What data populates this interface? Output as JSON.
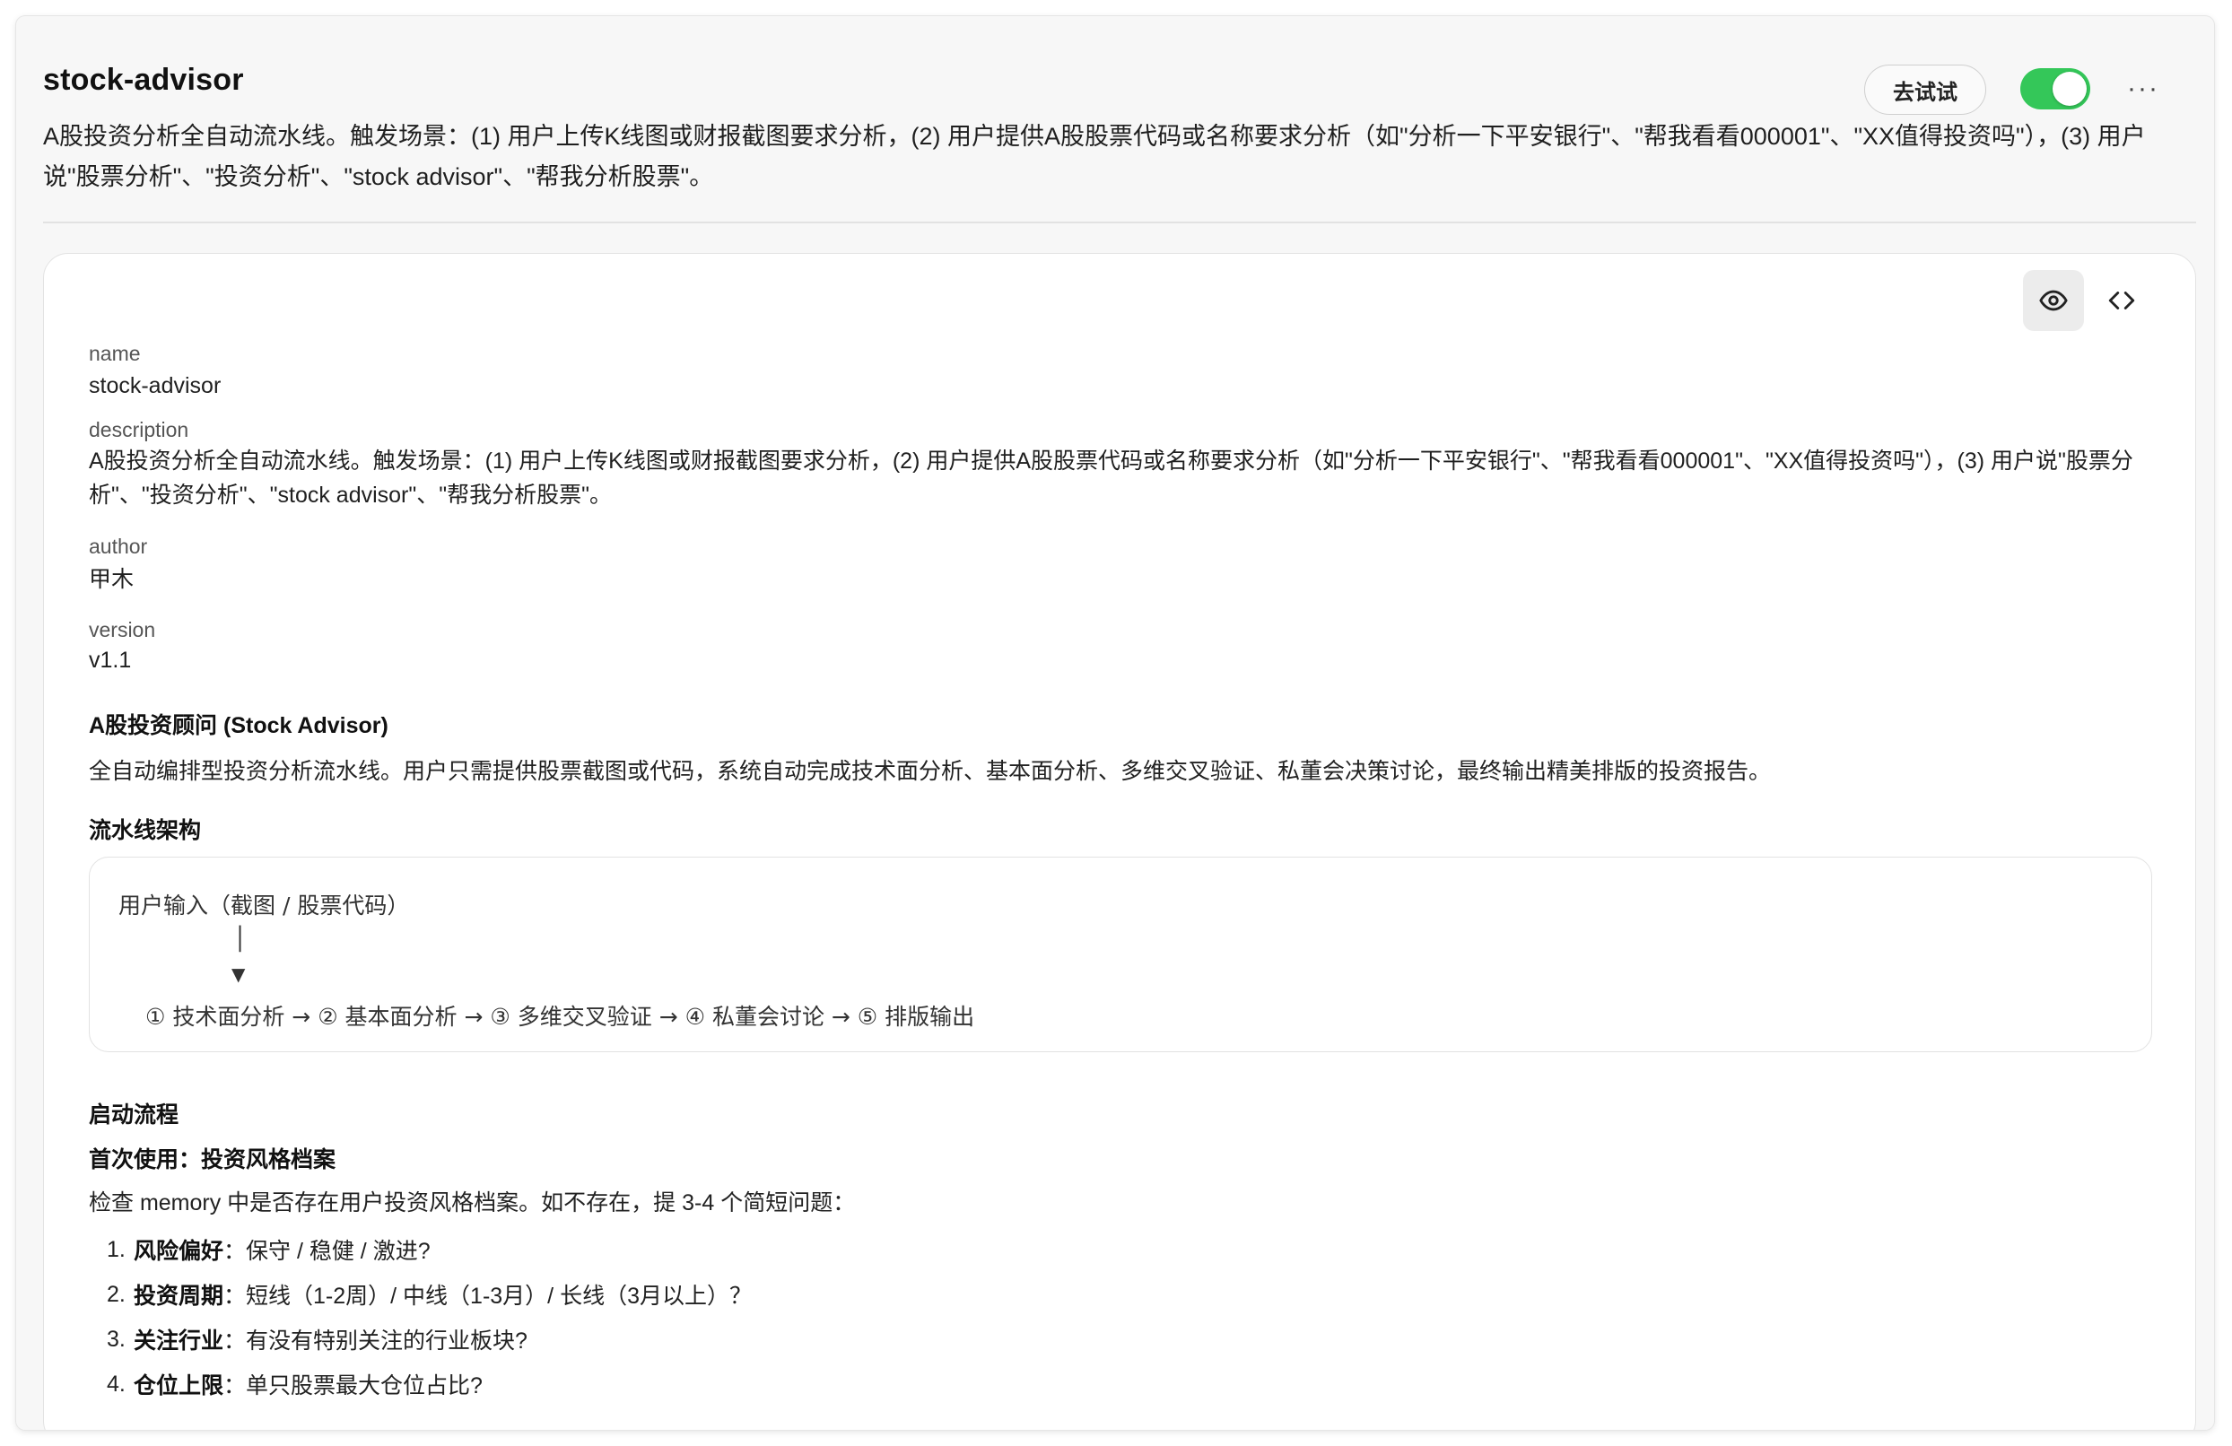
{
  "header": {
    "title": "stock-advisor",
    "try_label": "去试试",
    "toggle_on": true,
    "more_label": "···",
    "summary": "A股投资分析全自动流水线。触发场景：(1) 用户上传K线图或财报截图要求分析，(2) 用户提供A股股票代码或名称要求分析（如\"分析一下平安银行\"、\"帮我看看000001\"、\"XX值得投资吗\"），(3) 用户说\"股票分析\"、\"投资分析\"、\"stock advisor\"、\"帮我分析股票\"。"
  },
  "view": {
    "preview_icon": "eye-icon",
    "code_icon": "code-icon"
  },
  "meta": {
    "name_label": "name",
    "name_value": "stock-advisor",
    "description_label": "description",
    "description_value": "A股投资分析全自动流水线。触发场景：(1) 用户上传K线图或财报截图要求分析，(2) 用户提供A股股票代码或名称要求分析（如\"分析一下平安银行\"、\"帮我看看000001\"、\"XX值得投资吗\"），(3) 用户说\"股票分析\"、\"投资分析\"、\"stock advisor\"、\"帮我分析股票\"。",
    "author_label": "author",
    "author_value": "甲木",
    "version_label": "version",
    "version_value": "v1.1"
  },
  "doc": {
    "heading": "A股投资顾问 (Stock Advisor)",
    "intro": "全自动编排型投资分析流水线。用户只需提供股票截图或代码，系统自动完成技术面分析、基本面分析、多维交叉验证、私董会决策讨论，最终输出精美排版的投资报告。",
    "pipeline_heading": "流水线架构",
    "pipeline_code": {
      "line1": "用户输入（截图 / 股票代码）",
      "line2": "│",
      "line3": "▼",
      "line4": "① 技术面分析 → ② 基本面分析 → ③ 多维交叉验证 → ④ 私董会讨论 → ⑤ 排版输出"
    },
    "startup_heading": "启动流程",
    "first_use_heading": "首次使用：投资风格档案",
    "first_use_text": "检查 memory 中是否存在用户投资风格档案。如不存在，提 3-4 个简短问题：",
    "questions": [
      {
        "num": "1.",
        "label": "风险偏好",
        "text": "：保守 / 稳健 / 激进?"
      },
      {
        "num": "2.",
        "label": "投资周期",
        "text": "：短线（1-2周）/ 中线（1-3月）/ 长线（3月以上）？"
      },
      {
        "num": "3.",
        "label": "关注行业",
        "text": "：有没有特别关注的行业板块?"
      },
      {
        "num": "4.",
        "label": "仓位上限",
        "text": "：单只股票最大仓位占比?"
      }
    ]
  }
}
